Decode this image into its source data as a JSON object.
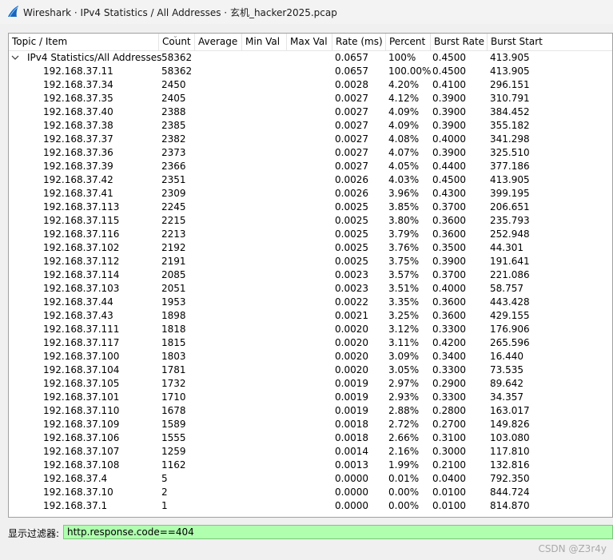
{
  "window": {
    "title": "Wireshark · IPv4 Statistics / All Addresses · 玄机_hacker2025.pcap"
  },
  "columns": {
    "topic": "Topic / Item",
    "count": "Count",
    "average": "Average",
    "min_val": "Min Val",
    "max_val": "Max Val",
    "rate": "Rate (ms)",
    "percent": "Percent",
    "burst_rate": "Burst Rate",
    "burst_start": "Burst Start"
  },
  "root": {
    "expander": "v",
    "topic": "IPv4 Statistics/All Addresses",
    "count": "58362",
    "rate": "0.0657",
    "percent": "100%",
    "burst_rate": "0.4500",
    "burst_start": "413.905"
  },
  "rows": [
    {
      "topic": "192.168.37.11",
      "count": "58362",
      "rate": "0.0657",
      "percent": "100.00%",
      "burst_rate": "0.4500",
      "burst_start": "413.905"
    },
    {
      "topic": "192.168.37.34",
      "count": "2450",
      "rate": "0.0028",
      "percent": "4.20%",
      "burst_rate": "0.4100",
      "burst_start": "296.151"
    },
    {
      "topic": "192.168.37.35",
      "count": "2405",
      "rate": "0.0027",
      "percent": "4.12%",
      "burst_rate": "0.3900",
      "burst_start": "310.791"
    },
    {
      "topic": "192.168.37.40",
      "count": "2388",
      "rate": "0.0027",
      "percent": "4.09%",
      "burst_rate": "0.3900",
      "burst_start": "384.452"
    },
    {
      "topic": "192.168.37.38",
      "count": "2385",
      "rate": "0.0027",
      "percent": "4.09%",
      "burst_rate": "0.3900",
      "burst_start": "355.182"
    },
    {
      "topic": "192.168.37.37",
      "count": "2382",
      "rate": "0.0027",
      "percent": "4.08%",
      "burst_rate": "0.4000",
      "burst_start": "341.298"
    },
    {
      "topic": "192.168.37.36",
      "count": "2373",
      "rate": "0.0027",
      "percent": "4.07%",
      "burst_rate": "0.3900",
      "burst_start": "325.510"
    },
    {
      "topic": "192.168.37.39",
      "count": "2366",
      "rate": "0.0027",
      "percent": "4.05%",
      "burst_rate": "0.4400",
      "burst_start": "377.186"
    },
    {
      "topic": "192.168.37.42",
      "count": "2351",
      "rate": "0.0026",
      "percent": "4.03%",
      "burst_rate": "0.4500",
      "burst_start": "413.905"
    },
    {
      "topic": "192.168.37.41",
      "count": "2309",
      "rate": "0.0026",
      "percent": "3.96%",
      "burst_rate": "0.4300",
      "burst_start": "399.195"
    },
    {
      "topic": "192.168.37.113",
      "count": "2245",
      "rate": "0.0025",
      "percent": "3.85%",
      "burst_rate": "0.3700",
      "burst_start": "206.651"
    },
    {
      "topic": "192.168.37.115",
      "count": "2215",
      "rate": "0.0025",
      "percent": "3.80%",
      "burst_rate": "0.3600",
      "burst_start": "235.793"
    },
    {
      "topic": "192.168.37.116",
      "count": "2213",
      "rate": "0.0025",
      "percent": "3.79%",
      "burst_rate": "0.3600",
      "burst_start": "252.948"
    },
    {
      "topic": "192.168.37.102",
      "count": "2192",
      "rate": "0.0025",
      "percent": "3.76%",
      "burst_rate": "0.3500",
      "burst_start": "44.301"
    },
    {
      "topic": "192.168.37.112",
      "count": "2191",
      "rate": "0.0025",
      "percent": "3.75%",
      "burst_rate": "0.3900",
      "burst_start": "191.641"
    },
    {
      "topic": "192.168.37.114",
      "count": "2085",
      "rate": "0.0023",
      "percent": "3.57%",
      "burst_rate": "0.3700",
      "burst_start": "221.086"
    },
    {
      "topic": "192.168.37.103",
      "count": "2051",
      "rate": "0.0023",
      "percent": "3.51%",
      "burst_rate": "0.4000",
      "burst_start": "58.757"
    },
    {
      "topic": "192.168.37.44",
      "count": "1953",
      "rate": "0.0022",
      "percent": "3.35%",
      "burst_rate": "0.3600",
      "burst_start": "443.428"
    },
    {
      "topic": "192.168.37.43",
      "count": "1898",
      "rate": "0.0021",
      "percent": "3.25%",
      "burst_rate": "0.3600",
      "burst_start": "429.155"
    },
    {
      "topic": "192.168.37.111",
      "count": "1818",
      "rate": "0.0020",
      "percent": "3.12%",
      "burst_rate": "0.3300",
      "burst_start": "176.906"
    },
    {
      "topic": "192.168.37.117",
      "count": "1815",
      "rate": "0.0020",
      "percent": "3.11%",
      "burst_rate": "0.4200",
      "burst_start": "265.596"
    },
    {
      "topic": "192.168.37.100",
      "count": "1803",
      "rate": "0.0020",
      "percent": "3.09%",
      "burst_rate": "0.3400",
      "burst_start": "16.440"
    },
    {
      "topic": "192.168.37.104",
      "count": "1781",
      "rate": "0.0020",
      "percent": "3.05%",
      "burst_rate": "0.3300",
      "burst_start": "73.535"
    },
    {
      "topic": "192.168.37.105",
      "count": "1732",
      "rate": "0.0019",
      "percent": "2.97%",
      "burst_rate": "0.2900",
      "burst_start": "89.642"
    },
    {
      "topic": "192.168.37.101",
      "count": "1710",
      "rate": "0.0019",
      "percent": "2.93%",
      "burst_rate": "0.3300",
      "burst_start": "34.357"
    },
    {
      "topic": "192.168.37.110",
      "count": "1678",
      "rate": "0.0019",
      "percent": "2.88%",
      "burst_rate": "0.2800",
      "burst_start": "163.017"
    },
    {
      "topic": "192.168.37.109",
      "count": "1589",
      "rate": "0.0018",
      "percent": "2.72%",
      "burst_rate": "0.2700",
      "burst_start": "149.826"
    },
    {
      "topic": "192.168.37.106",
      "count": "1555",
      "rate": "0.0018",
      "percent": "2.66%",
      "burst_rate": "0.3100",
      "burst_start": "103.080"
    },
    {
      "topic": "192.168.37.107",
      "count": "1259",
      "rate": "0.0014",
      "percent": "2.16%",
      "burst_rate": "0.3000",
      "burst_start": "117.810"
    },
    {
      "topic": "192.168.37.108",
      "count": "1162",
      "rate": "0.0013",
      "percent": "1.99%",
      "burst_rate": "0.2100",
      "burst_start": "132.816"
    },
    {
      "topic": "192.168.37.4",
      "count": "5",
      "rate": "0.0000",
      "percent": "0.01%",
      "burst_rate": "0.0400",
      "burst_start": "792.350"
    },
    {
      "topic": "192.168.37.10",
      "count": "2",
      "rate": "0.0000",
      "percent": "0.00%",
      "burst_rate": "0.0100",
      "burst_start": "844.724"
    },
    {
      "topic": "192.168.37.1",
      "count": "1",
      "rate": "0.0000",
      "percent": "0.00%",
      "burst_rate": "0.0100",
      "burst_start": "814.870"
    }
  ],
  "filter": {
    "label": "显示过滤器:",
    "value": "http.response.code==404"
  },
  "watermark": "CSDN @Z3r4y",
  "colors": {
    "filter_bg": "#afffaf",
    "panel_bg": "#ffffff",
    "window_bg": "#f0f0f0",
    "shark_fin": "#1565c0"
  }
}
